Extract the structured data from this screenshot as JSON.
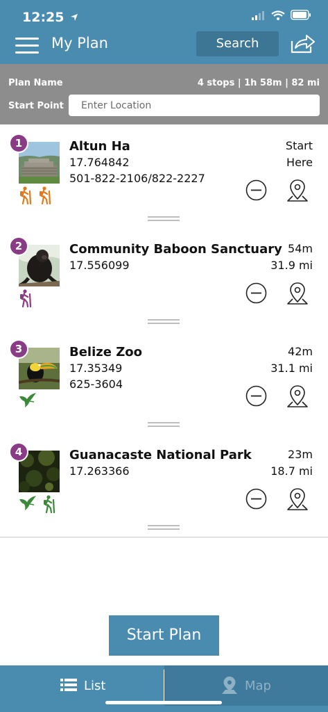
{
  "status": {
    "time": "12:25"
  },
  "header": {
    "title": "My Plan",
    "search_label": "Search"
  },
  "plan": {
    "name_label": "Plan Name",
    "summary": "4 stops | 1h 58m | 82 mi",
    "start_label": "Start Point",
    "start_placeholder": "Enter Location"
  },
  "stops": [
    {
      "number": "1",
      "name": "Altun Ha",
      "coord": "17.764842",
      "phone": "501-822-2106/822-2227",
      "meta_top": "Start",
      "meta_bottom": "Here",
      "activities": [
        "hiking-icon",
        "hiking-icon"
      ]
    },
    {
      "number": "2",
      "name": "Community Baboon Sanctuary",
      "coord": "17.556099",
      "phone": "",
      "meta_top": "54m",
      "meta_bottom": "31.9 mi",
      "activities": [
        "hiking-icon"
      ]
    },
    {
      "number": "3",
      "name": "Belize Zoo",
      "coord": "17.35349",
      "phone": "625-3604",
      "meta_top": "42m",
      "meta_bottom": "31.1 mi",
      "activities": [
        "bird-icon"
      ]
    },
    {
      "number": "4",
      "name": "Guanacaste National Park",
      "coord": "17.263366",
      "phone": "",
      "meta_top": "23m",
      "meta_bottom": "18.7 mi",
      "activities": [
        "bird-icon",
        "hiking-icon"
      ]
    }
  ],
  "footer": {
    "start_plan_label": "Start Plan"
  },
  "tabs": {
    "list_label": "List",
    "map_label": "Map"
  },
  "colors": {
    "brand": "#4a8bb0",
    "badge": "#8a3b85",
    "hike_orange": "#e07a1f",
    "hike_purple": "#8a3b85",
    "bird_green": "#3a8a3a"
  }
}
